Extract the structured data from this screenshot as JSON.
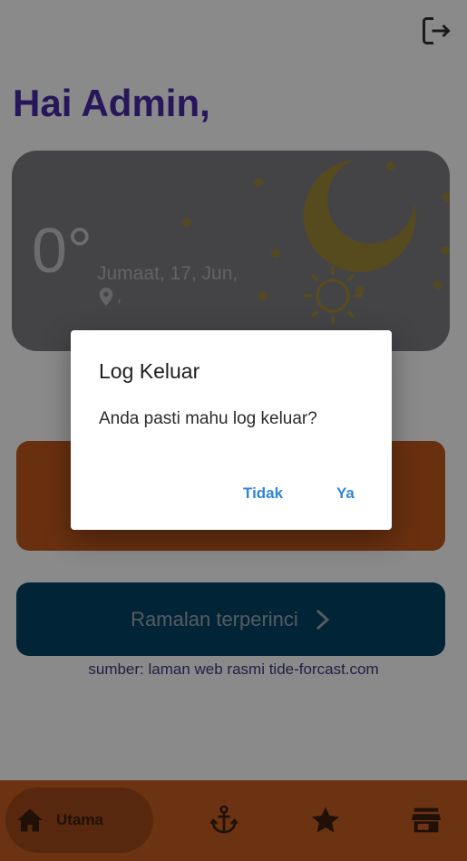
{
  "header": {
    "greeting": "Hai Admin,",
    "logout_icon": "logout-icon"
  },
  "weather": {
    "temperature": "0°",
    "date": "Jumaat, 17, Jun,",
    "location": ",",
    "icons": [
      "moon-icon",
      "sun-icon",
      "location-pin-icon"
    ]
  },
  "forecast_button": {
    "label": "Ramalan terperinci",
    "icon": "chevron-right-icon"
  },
  "source_text": "sumber: laman web rasmi tide-forcast.com",
  "bottom_nav": {
    "items": [
      {
        "label": "Utama",
        "icon": "home-icon",
        "active": true
      },
      {
        "label": "",
        "icon": "anchor-icon"
      },
      {
        "label": "",
        "icon": "star-icon"
      },
      {
        "label": "",
        "icon": "store-icon"
      }
    ]
  },
  "dialog": {
    "title": "Log Keluar",
    "message": "Anda pasti mahu log keluar?",
    "cancel_label": "Tidak",
    "confirm_label": "Ya"
  },
  "colors": {
    "greeting": "#4a2aa8",
    "weather_card": "#7f7f83",
    "orange_card": "#c2591e",
    "forecast_button": "#054366",
    "bottom_nav": "#c75e22",
    "dialog_button": "#2f86d6"
  }
}
